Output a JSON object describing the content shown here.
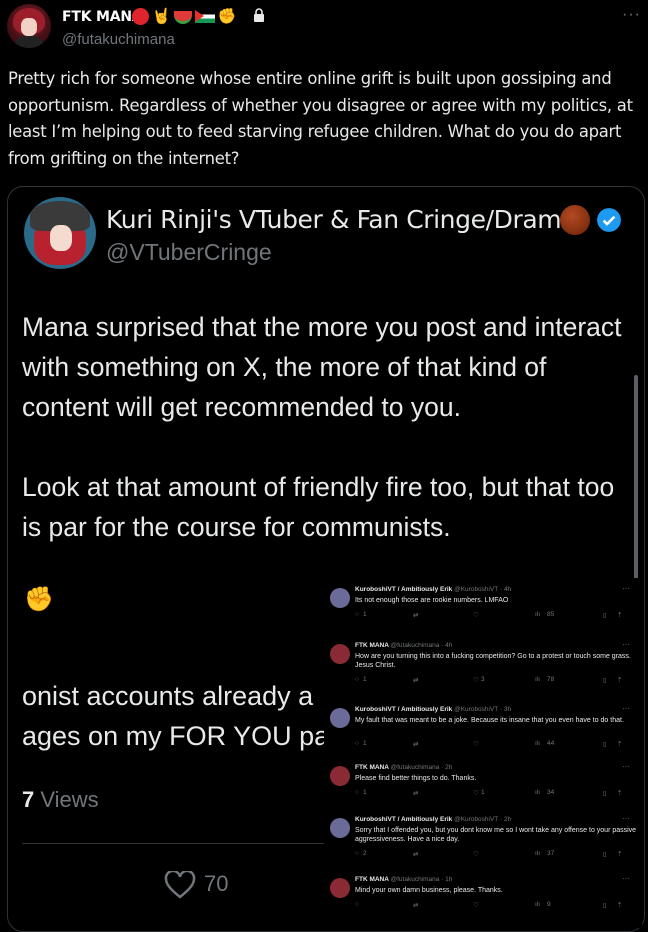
{
  "header": {
    "display_name": "FTK MANA",
    "handle": "@futakuchimana",
    "more": "···"
  },
  "tweet": {
    "text": "Pretty rich for someone whose entire online grift is built upon gossiping and opportunism. Regardless of whether you disagree or agree with my politics, at least I’m helping out to feed starving refugee children. What do you do apart from grifting on the internet?"
  },
  "quoted": {
    "display_name": "Kuri Rinji's VTuber & Fan Cringe/Drama",
    "handle": "@VTuberCringe",
    "paragraph1": "Mana surprised that the more you post and interact with something on X, the more of that kind of content will get recommended to you.",
    "paragraph2": "Look at that amount of friendly fire too, but that too is par for the course for communists.",
    "fragment1": "onist accounts already a",
    "fragment2": "ages on my FOR YOU pa",
    "views_count": "7",
    "views_label": "Views",
    "likes": "70"
  },
  "replies": [
    {
      "name": "KuroboshiVT",
      "suffix": "/ Ambitiously Erik",
      "meta": "@KuroboshiVT · 4h",
      "text": "Its not enough those are rookie numbers. LMFAO",
      "replies": "1",
      "likes": "",
      "views": "85",
      "color": "#6b6b9a"
    },
    {
      "name": "FTK MANA",
      "suffix": "",
      "meta": "@futakuchimana · 4h",
      "text": "How are you turning this into a fucking competition? Go to a protest or touch some grass. Jesus Christ.",
      "replies": "1",
      "likes": "3",
      "views": "78",
      "color": "#8a2a34"
    },
    {
      "name": "KuroboshiVT",
      "suffix": "/ Ambitiously Erik",
      "meta": "@KuroboshiVT · 3h",
      "text": "My fault that was meant to be a joke. Because its insane that you even have to do that.",
      "replies": "1",
      "likes": "",
      "views": "44",
      "color": "#6b6b9a"
    },
    {
      "name": "FTK MANA",
      "suffix": "",
      "meta": "@futakuchimana · 2h",
      "text": "Please find better things to do. Thanks.",
      "replies": "1",
      "likes": "1",
      "views": "34",
      "color": "#8a2a34"
    },
    {
      "name": "KuroboshiVT",
      "suffix": "/ Ambitiously Erik",
      "meta": "@KuroboshiVT · 2h",
      "text": "Sorry that I offended you, but you dont know me so I wont take any offense to your passive aggressiveness. Have a nice day.",
      "replies": "2",
      "likes": "",
      "views": "37",
      "color": "#6b6b9a"
    },
    {
      "name": "FTK MANA",
      "suffix": "",
      "meta": "@futakuchimana · 1h",
      "text": "Mind your own damn business, please. Thanks.",
      "replies": "",
      "likes": "",
      "views": "9",
      "color": "#8a2a34"
    }
  ]
}
